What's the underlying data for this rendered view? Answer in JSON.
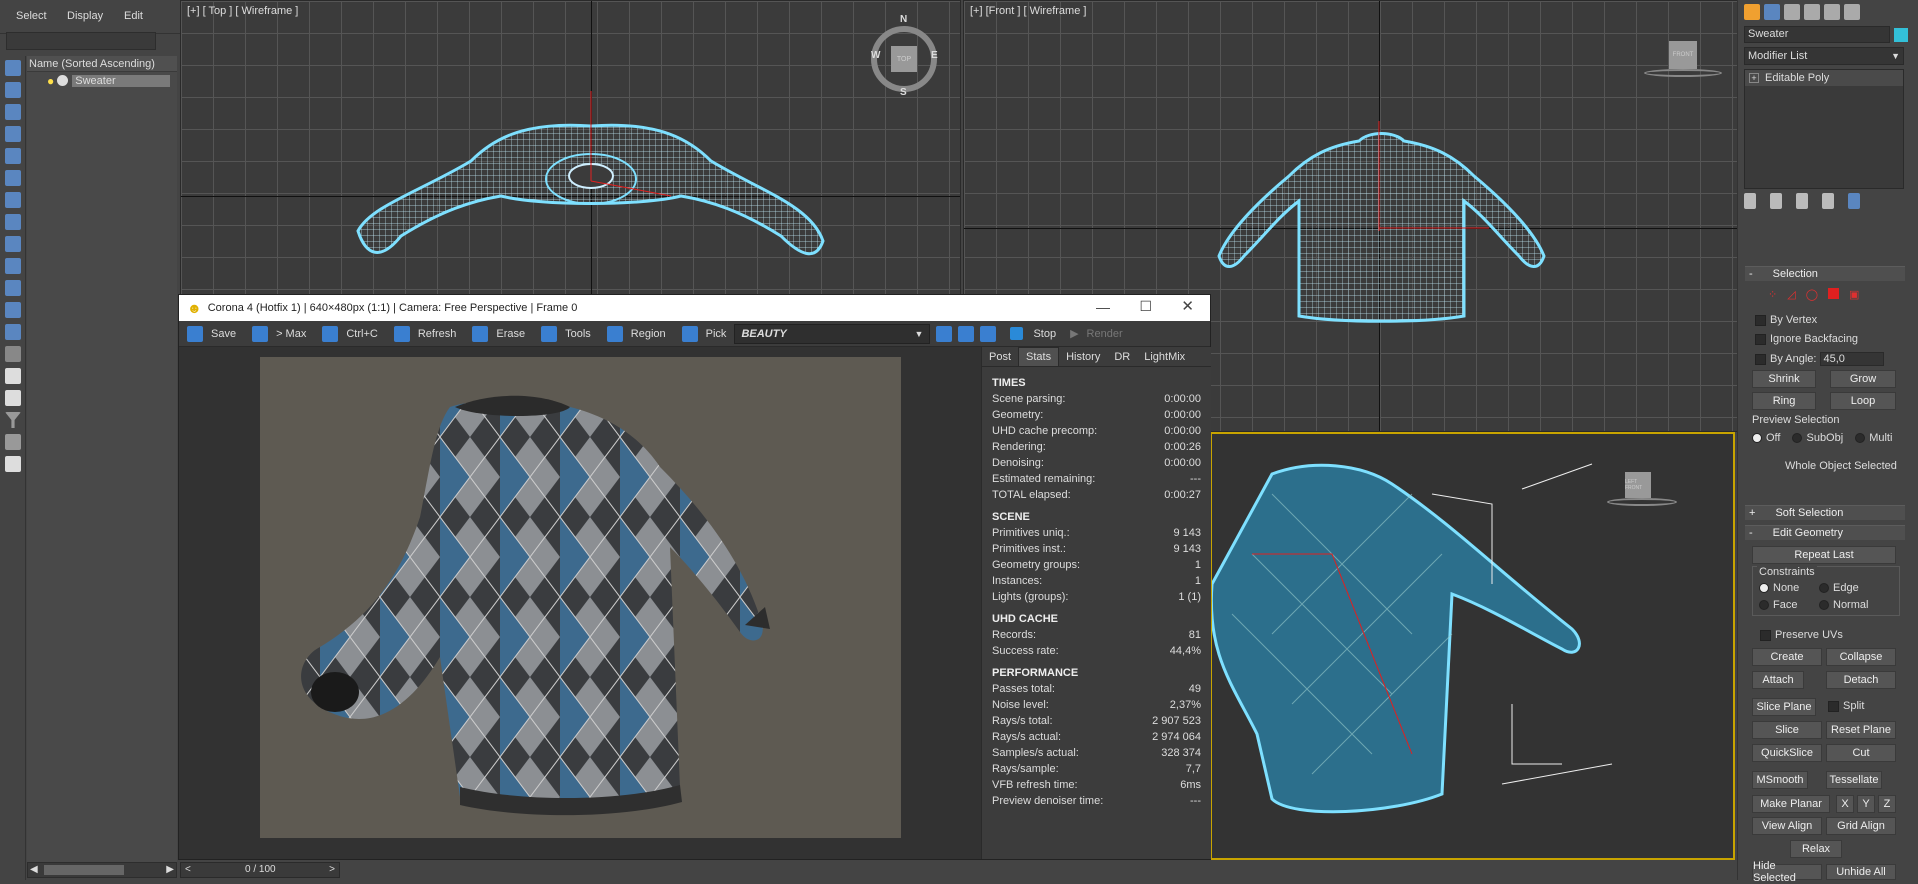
{
  "menu": {
    "select": "Select",
    "display": "Display",
    "edit": "Edit"
  },
  "scene_explorer": {
    "header": "Name (Sorted Ascending)",
    "item": "Sweater"
  },
  "viewports": {
    "top": "[+] [ Top ] [ Wireframe ]",
    "front": "[+] [Front ] [ Wireframe ]",
    "compass": {
      "n": "N",
      "s": "S",
      "e": "E",
      "w": "W"
    },
    "cube_top": "TOP",
    "cube_front": "FRONT",
    "cube_persp": "LEFT FRONT"
  },
  "vfb": {
    "title": "Corona 4 (Hotfix 1) | 640×480px (1:1) | Camera: Free Perspective | Frame 0",
    "toolbar": {
      "save": "Save",
      "max": "> Max",
      "ctrlc": "Ctrl+C",
      "refresh": "Refresh",
      "erase": "Erase",
      "tools": "Tools",
      "region": "Region",
      "pick": "Pick",
      "pass": "BEAUTY",
      "stop": "Stop",
      "render": "Render"
    },
    "tabs": [
      "Post",
      "Stats",
      "History",
      "DR",
      "LightMix"
    ],
    "active_tab": "Stats",
    "times_title": "TIMES",
    "times": [
      {
        "k": "Scene parsing:",
        "v": "0:00:00"
      },
      {
        "k": "Geometry:",
        "v": "0:00:00"
      },
      {
        "k": "UHD cache precomp:",
        "v": "0:00:00"
      },
      {
        "k": "Rendering:",
        "v": "0:00:26"
      },
      {
        "k": "Denoising:",
        "v": "0:00:00"
      },
      {
        "k": "Estimated remaining:",
        "v": "---"
      },
      {
        "k": "TOTAL elapsed:",
        "v": "0:00:27"
      }
    ],
    "scene_title": "SCENE",
    "scene": [
      {
        "k": "Primitives uniq.:",
        "v": "9 143"
      },
      {
        "k": "Primitives inst.:",
        "v": "9 143"
      },
      {
        "k": "Geometry groups:",
        "v": "1"
      },
      {
        "k": "Instances:",
        "v": "1"
      },
      {
        "k": "Lights (groups):",
        "v": "1 (1)"
      }
    ],
    "uhd_title": "UHD CACHE",
    "uhd": [
      {
        "k": "Records:",
        "v": "81"
      },
      {
        "k": "Success rate:",
        "v": "44,4%"
      }
    ],
    "perf_title": "PERFORMANCE",
    "perf": [
      {
        "k": "Passes total:",
        "v": "49"
      },
      {
        "k": "Noise level:",
        "v": "2,37%"
      },
      {
        "k": "Rays/s total:",
        "v": "2 907 523"
      },
      {
        "k": "Rays/s actual:",
        "v": "2 974 064"
      },
      {
        "k": "Samples/s actual:",
        "v": "328 374"
      },
      {
        "k": "Rays/sample:",
        "v": "7,7"
      },
      {
        "k": "VFB refresh time:",
        "v": "6ms"
      },
      {
        "k": "Preview denoiser time:",
        "v": "---"
      }
    ]
  },
  "timeline": {
    "frame": "0 / 100"
  },
  "cmd": {
    "object_name": "Sweater",
    "modifier_list": "Modifier List",
    "stack_item": "Editable Poly",
    "selection": "Selection",
    "by_vertex": "By Vertex",
    "ignore_backfacing": "Ignore Backfacing",
    "by_angle": "By Angle:",
    "angle_value": "45,0",
    "shrink": "Shrink",
    "grow": "Grow",
    "ring": "Ring",
    "loop": "Loop",
    "preview_selection": "Preview Selection",
    "off": "Off",
    "subobj": "SubObj",
    "multi": "Multi",
    "whole_object": "Whole Object Selected",
    "soft_selection": "Soft Selection",
    "edit_geometry": "Edit Geometry",
    "repeat_last": "Repeat Last",
    "constraints": "Constraints",
    "none": "None",
    "edge": "Edge",
    "face": "Face",
    "normal": "Normal",
    "preserve_uvs": "Preserve UVs",
    "create": "Create",
    "collapse": "Collapse",
    "attach": "Attach",
    "detach": "Detach",
    "slice_plane": "Slice Plane",
    "split": "Split",
    "slice": "Slice",
    "reset_plane": "Reset Plane",
    "quickslice": "QuickSlice",
    "cut": "Cut",
    "msmooth": "MSmooth",
    "tessellate": "Tessellate",
    "make_planar": "Make Planar",
    "x": "X",
    "y": "Y",
    "z": "Z",
    "view_align": "View Align",
    "grid_align": "Grid Align",
    "relax": "Relax",
    "hide_selected": "Hide Selected",
    "unhide_all": "Unhide All"
  },
  "colors": {
    "accent": "#7ee0ff",
    "selection_red": "#e02020",
    "object_color": "#33c0d8"
  }
}
